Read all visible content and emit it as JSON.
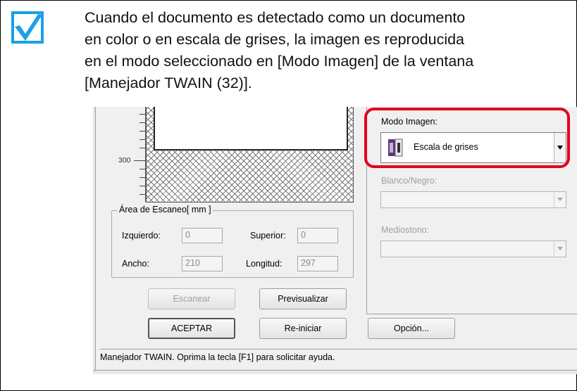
{
  "note": {
    "lines": [
      "Cuando el documento es detectado como un documento",
      "en color o en escala de grises, la imagen es reproducida",
      "en el modo seleccionado en [Modo Imagen] de la ventana",
      "[Manejador TWAIN (32)]."
    ]
  },
  "dialog": {
    "ruler_label": "300",
    "scan_area": {
      "title": "Área de Escaneo[ mm ]",
      "left_label": "Izquierdo:",
      "left_value": "0",
      "top_label": "Superior:",
      "top_value": "0",
      "width_label": "Ancho:",
      "width_value": "210",
      "length_label": "Longitud:",
      "length_value": "297"
    },
    "buttons": {
      "scan": "Escanear",
      "preview": "Previsualizar",
      "ok": "ACEPTAR",
      "reset": "Re-iniciar",
      "option": "Opción..."
    },
    "image_mode": {
      "label": "Modo Imagen:",
      "value": "Escala de grises"
    },
    "black_white": {
      "label": "Blanco/Negro:",
      "value": ""
    },
    "halftone": {
      "label": "Mediostono:",
      "value": ""
    },
    "status": "Manejador TWAIN. Oprima la tecla [F1] para solicitar ayuda."
  },
  "colors": {
    "check": "#1aa0e8",
    "highlight": "#e4001b"
  },
  "icons": {
    "check": "checkmark-icon",
    "image_mode": "grayscale-mode-icon"
  }
}
